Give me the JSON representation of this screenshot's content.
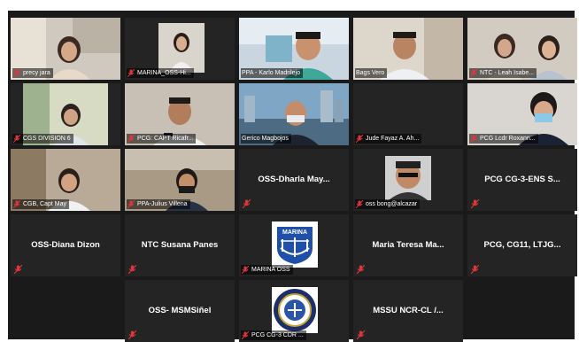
{
  "participants": [
    {
      "name": "precy jara",
      "type": "video"
    },
    {
      "name": "MARINA_OSS-Hi...",
      "type": "video"
    },
    {
      "name": "PPA - Karlo Madrilejo",
      "type": "video"
    },
    {
      "name": "Bags Vero",
      "type": "video"
    },
    {
      "name": "NTC - Leah Isabe...",
      "type": "video"
    },
    {
      "name": "CGS DIVISION 6",
      "type": "video"
    },
    {
      "name": "PCG: CAPT Ricafr...",
      "type": "video"
    },
    {
      "name": "Gerico Magbojos",
      "type": "video",
      "active_speaker": true
    },
    {
      "name": "Jude Fayaz A. Ah...",
      "type": "blank"
    },
    {
      "name": "PCG Lcdr Roxann...",
      "type": "video"
    },
    {
      "name": "CGB, Capt May",
      "type": "video"
    },
    {
      "name": "PPA-Julius Villena",
      "type": "video"
    },
    {
      "name": "OSS-Dharla May...",
      "type": "name"
    },
    {
      "name": "oss bong@alcazar",
      "type": "avatar"
    },
    {
      "name": "PCG CG-3-ENS S...",
      "type": "name"
    },
    {
      "name": "OSS-Diana Dizon",
      "type": "name"
    },
    {
      "name": "NTC Susana Panes",
      "type": "name"
    },
    {
      "name": "MARINA OSS",
      "type": "logo",
      "logo_text": "MARINA"
    },
    {
      "name": "Maria Teresa Ma...",
      "type": "name"
    },
    {
      "name": "PCG, CG11, LTJG...",
      "type": "name"
    },
    {
      "name": "OSS- MSMSiñel",
      "type": "name"
    },
    {
      "name": "PCG CG-3 CDR ...",
      "type": "seal"
    },
    {
      "name": "MSSU NCR-CL /...",
      "type": "name"
    }
  ],
  "colors": {
    "tile_bg": "#242424",
    "grid_bg": "#1a1a1a",
    "active_border": "#d8e84a",
    "muted_mic": "#e0363b"
  }
}
